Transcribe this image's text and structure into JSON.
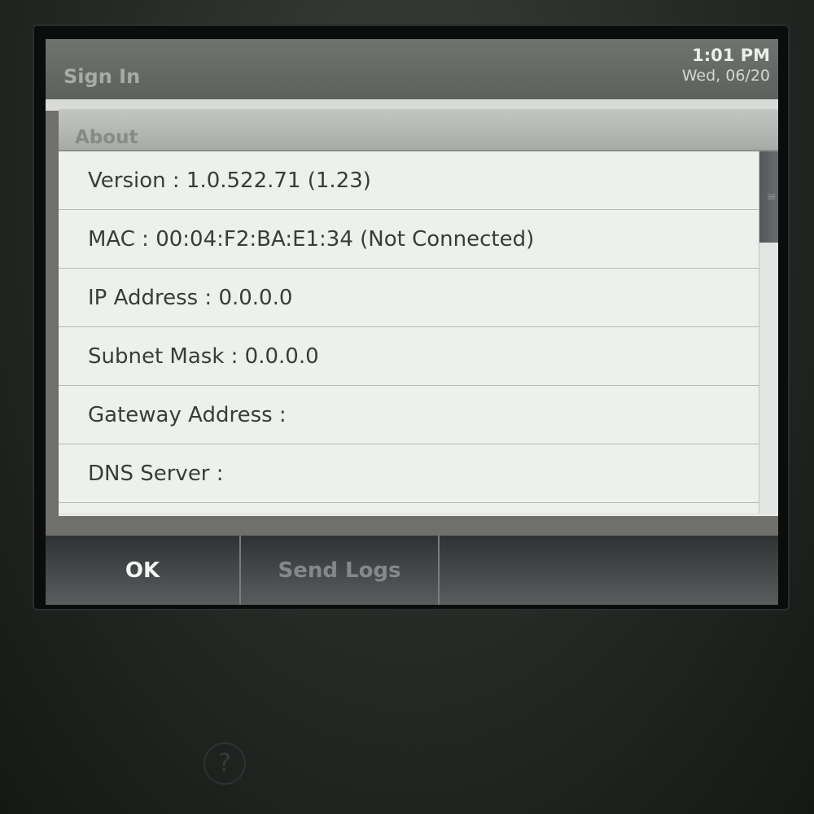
{
  "titlebar": {
    "title": "Sign In",
    "time": "1:01 PM",
    "date": "Wed, 06/20"
  },
  "dialog": {
    "title": "About",
    "rows": [
      "Version : 1.0.522.71 (1.23)",
      "MAC : 00:04:F2:BA:E1:34 (Not Connected)",
      "IP Address : 0.0.0.0",
      "Subnet Mask : 0.0.0.0",
      "Gateway Address :",
      "DNS Server :"
    ]
  },
  "footer": {
    "ok_label": "OK",
    "send_logs_label": "Send Logs"
  },
  "device": {
    "help_icon": "?"
  }
}
